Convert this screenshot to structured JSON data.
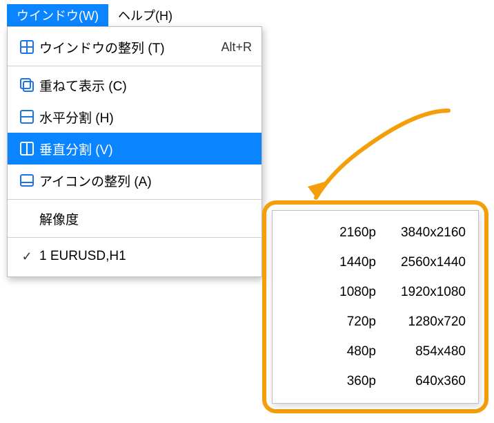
{
  "menubar": {
    "window": "ウインドウ(W)",
    "help": "ヘルプ(H)"
  },
  "menu": {
    "arrange": {
      "label": "ウインドウの整列 (T)",
      "shortcut": "Alt+R"
    },
    "cascade": {
      "label": "重ねて表示 (C)"
    },
    "tile_h": {
      "label": "水平分割 (H)"
    },
    "tile_v": {
      "label": "垂直分割 (V)"
    },
    "arrange_icons": {
      "label": "アイコンの整列 (A)"
    },
    "resolution": {
      "label": "解像度"
    },
    "window_1": {
      "label": "1 EURUSD,H1"
    }
  },
  "resolutions": [
    {
      "label": "2160p",
      "value": "3840x2160"
    },
    {
      "label": "1440p",
      "value": "2560x1440"
    },
    {
      "label": "1080p",
      "value": "1920x1080"
    },
    {
      "label": "720p",
      "value": "1280x720"
    },
    {
      "label": "480p",
      "value": "854x480"
    },
    {
      "label": "360p",
      "value": "640x360"
    }
  ]
}
